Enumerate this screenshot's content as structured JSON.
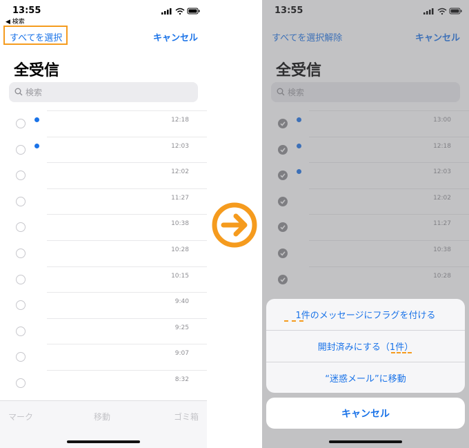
{
  "left": {
    "status": {
      "time": "13:55",
      "back_label": "◀ 検索"
    },
    "nav": {
      "select_all": "すべてを選択",
      "cancel": "キャンセル"
    },
    "title": "全受信",
    "search": {
      "placeholder": "検索"
    },
    "rows": [
      {
        "time": "12:18",
        "unread": true
      },
      {
        "time": "12:03",
        "unread": true
      },
      {
        "time": "12:02",
        "unread": false
      },
      {
        "time": "11:27",
        "unread": false
      },
      {
        "time": "10:38",
        "unread": false
      },
      {
        "time": "10:28",
        "unread": false
      },
      {
        "time": "10:15",
        "unread": false
      },
      {
        "time": "9:40",
        "unread": false
      },
      {
        "time": "9:25",
        "unread": false
      },
      {
        "time": "9:07",
        "unread": false
      },
      {
        "time": "8:32",
        "unread": false
      }
    ],
    "toolbar": {
      "mark": "マーク",
      "move": "移動",
      "trash": "ゴミ箱"
    }
  },
  "right": {
    "status": {
      "time": "13:55"
    },
    "nav": {
      "deselect_all": "すべてを選択解除",
      "cancel": "キャンセル"
    },
    "title": "全受信",
    "search": {
      "placeholder": "検索"
    },
    "rows": [
      {
        "time": "13:00",
        "unread": true
      },
      {
        "time": "12:18",
        "unread": true
      },
      {
        "time": "12:03",
        "unread": true
      },
      {
        "time": "12:02",
        "unread": false
      },
      {
        "time": "11:27",
        "unread": false
      },
      {
        "time": "10:38",
        "unread": false
      },
      {
        "time": "10:28",
        "unread": false
      }
    ],
    "action_sheet": {
      "flag": "1件のメッセージにフラグを付ける",
      "mark_read": "開封済みにする（1件）",
      "junk": "“迷惑メール”に移動",
      "cancel": "キャンセル"
    }
  },
  "colors": {
    "accent": "#1a73e8",
    "highlight": "#f59b1e"
  }
}
